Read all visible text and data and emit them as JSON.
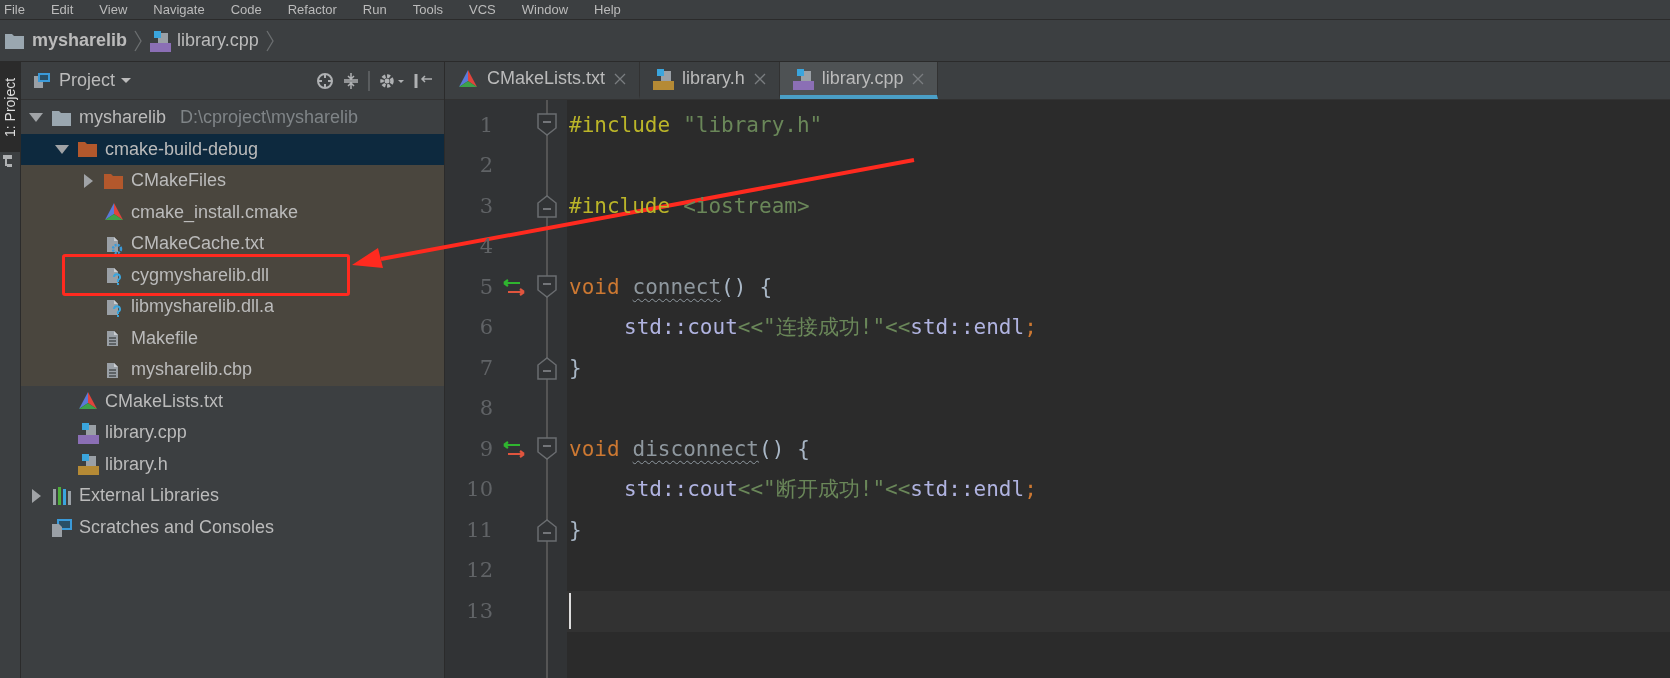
{
  "menu": [
    "File",
    "Edit",
    "View",
    "Navigate",
    "Code",
    "Refactor",
    "Run",
    "Tools",
    "VCS",
    "Window",
    "Help"
  ],
  "breadcrumb": [
    {
      "label": "mysharelib",
      "kind": "folder"
    },
    {
      "label": "library.cpp",
      "kind": "cpp"
    }
  ],
  "tool_stripe": {
    "label": "1: Project",
    "selected": true
  },
  "project_panel": {
    "title": "Project",
    "tree": [
      {
        "label": "mysharelib",
        "path": "D:\\cproject\\mysharelib",
        "kind": "folder",
        "expanded": true,
        "selected": false,
        "children": [
          {
            "label": "cmake-build-debug",
            "kind": "excluded-folder",
            "expanded": true,
            "selected": true,
            "excluded": true,
            "children": [
              {
                "label": "CMakeFiles",
                "kind": "excluded-folder",
                "expanded": false,
                "selected": false
              },
              {
                "label": "cmake_install.cmake",
                "kind": "cmake",
                "selected": false
              },
              {
                "label": "CMakeCache.txt",
                "kind": "settings-file",
                "selected": false
              },
              {
                "label": "cygmysharelib.dll",
                "kind": "unknown-file",
                "selected": false
              },
              {
                "label": "libmysharelib.dll.a",
                "kind": "unknown-file",
                "selected": false
              },
              {
                "label": "Makefile",
                "kind": "text-file",
                "selected": false
              },
              {
                "label": "mysharelib.cbp",
                "kind": "text-file",
                "selected": false
              }
            ]
          },
          {
            "label": "CMakeLists.txt",
            "kind": "cmake",
            "selected": false
          },
          {
            "label": "library.cpp",
            "kind": "cpp",
            "selected": false
          },
          {
            "label": "library.h",
            "kind": "header",
            "selected": false
          }
        ]
      },
      {
        "label": "External Libraries",
        "kind": "libraries",
        "expanded": false,
        "selected": false
      },
      {
        "label": "Scratches and Consoles",
        "kind": "scratches",
        "selected": false
      }
    ]
  },
  "editor_tabs": [
    {
      "label": "CMakeLists.txt",
      "kind": "cmake",
      "selected": false
    },
    {
      "label": "library.h",
      "kind": "header",
      "selected": false
    },
    {
      "label": "library.cpp",
      "kind": "cpp",
      "selected": true
    }
  ],
  "code_lines": [
    {
      "number": "1",
      "fold_start": true,
      "tokens": [
        {
          "text": "#include",
          "kind": "preprocessor"
        },
        {
          "text": "\"library.h\"",
          "kind": "string",
          "spaced": true
        }
      ]
    },
    {
      "number": "2"
    },
    {
      "number": "3",
      "fold_end": true,
      "tokens": [
        {
          "text": "#include",
          "kind": "preprocessor"
        },
        {
          "text": "<iostream>",
          "kind": "string",
          "spaced": true
        }
      ]
    },
    {
      "number": "4"
    },
    {
      "number": "5",
      "fold_start": true,
      "override": true,
      "tokens": [
        {
          "text": "void",
          "kind": "keyword"
        },
        {
          "text": "connect",
          "kind": "unused",
          "spaced": true
        },
        {
          "text": "()",
          "kind": "plain"
        },
        {
          "text": "{",
          "kind": "plain",
          "spaced": true
        }
      ]
    },
    {
      "number": "6",
      "indented": true,
      "tokens": [
        {
          "text": "std::cout",
          "kind": "ident"
        },
        {
          "text": "<<",
          "kind": "operator"
        },
        {
          "text": "\"连接成功!\"",
          "kind": "string"
        },
        {
          "text": "<<",
          "kind": "operator"
        },
        {
          "text": "std::endl",
          "kind": "ident"
        },
        {
          "text": ";",
          "kind": "semicolon"
        }
      ]
    },
    {
      "number": "7",
      "fold_end": true,
      "tokens": [
        {
          "text": "}",
          "kind": "plain"
        }
      ]
    },
    {
      "number": "8"
    },
    {
      "number": "9",
      "fold_start": true,
      "override": true,
      "tokens": [
        {
          "text": "void",
          "kind": "keyword"
        },
        {
          "text": "disconnect",
          "kind": "unused",
          "spaced": true
        },
        {
          "text": "()",
          "kind": "plain"
        },
        {
          "text": "{",
          "kind": "plain",
          "spaced": true
        }
      ]
    },
    {
      "number": "10",
      "indented": true,
      "tokens": [
        {
          "text": "std::cout",
          "kind": "ident"
        },
        {
          "text": "<<",
          "kind": "operator"
        },
        {
          "text": "\"断开成功!\"",
          "kind": "string"
        },
        {
          "text": "<<",
          "kind": "operator"
        },
        {
          "text": "std::endl",
          "kind": "ident"
        },
        {
          "text": ";",
          "kind": "semicolon"
        }
      ]
    },
    {
      "number": "11",
      "fold_end": true,
      "tokens": [
        {
          "text": "}",
          "kind": "plain"
        }
      ]
    },
    {
      "number": "12"
    },
    {
      "number": "13",
      "current": true
    }
  ],
  "highlight_box": {
    "color": "#ff2a1f"
  },
  "arrow": {
    "color": "#ff2a1f"
  }
}
